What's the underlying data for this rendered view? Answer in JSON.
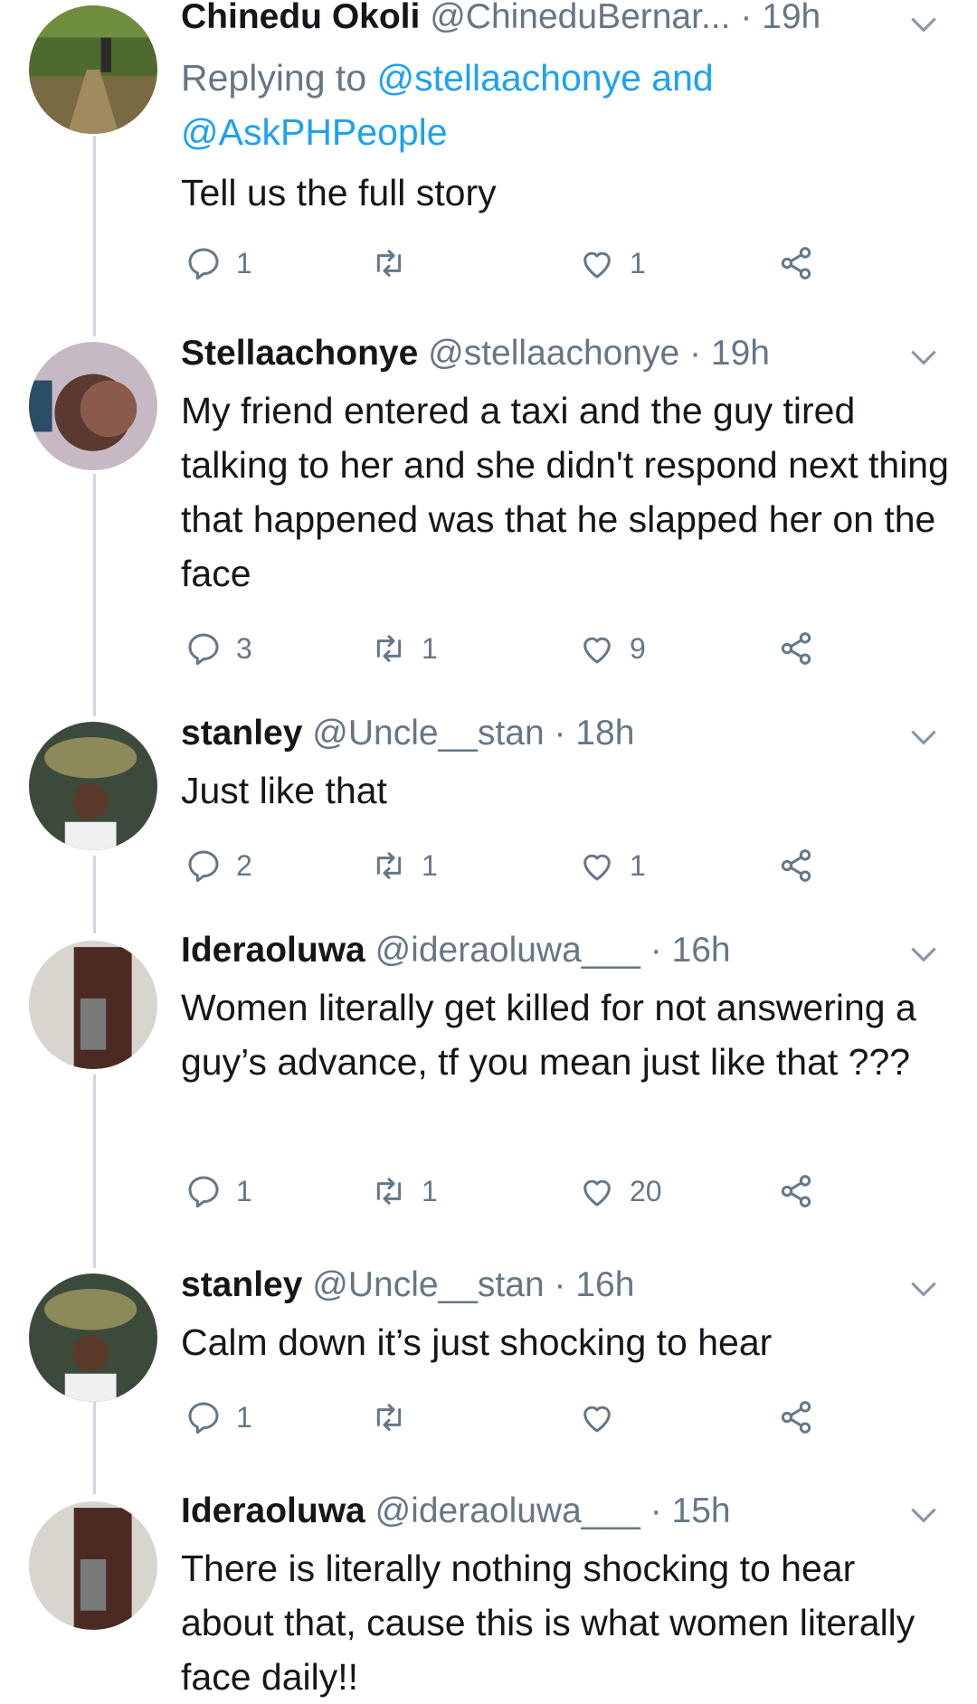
{
  "tweets": [
    {
      "name": "Chinedu Okoli",
      "handle": "@ChineduBernar...",
      "time": "· 19h",
      "replying_prefix": "Replying to",
      "replying_mention1": "@stellaachonye and",
      "replying_mention2": "@AskPHPeople",
      "text": "Tell us the full story",
      "replies": "1",
      "retweets": "",
      "likes": "1"
    },
    {
      "name": "Stellaachonye",
      "handle": "@stellaachonye",
      "time": "· 19h",
      "text": "My friend entered a taxi and the guy tired talking to her and she didn't respond next thing that happened was that he slapped her on the face",
      "replies": "3",
      "retweets": "1",
      "likes": "9"
    },
    {
      "name": "stanley",
      "handle": "@Uncle__stan",
      "time": "· 18h",
      "text": "Just like that",
      "replies": "2",
      "retweets": "1",
      "likes": "1"
    },
    {
      "name": "Ideraoluwa",
      "handle": "@ideraoluwa___",
      "time": "· 16h",
      "text": "Women literally get killed for not answering a guy’s advance, tf you mean just like that ???",
      "replies": "1",
      "retweets": "1",
      "likes": "20"
    },
    {
      "name": "stanley",
      "handle": "@Uncle__stan",
      "time": "· 16h",
      "text": "Calm down it’s just shocking to hear",
      "replies": "1",
      "retweets": "",
      "likes": ""
    },
    {
      "name": "Ideraoluwa",
      "handle": "@ideraoluwa___",
      "time": "· 15h",
      "text": "There is literally nothing shocking to hear about that, cause this is what women literally face daily!!"
    }
  ],
  "icons": {
    "reply": "reply-icon",
    "retweet": "retweet-icon",
    "like": "heart-icon",
    "share": "share-icon",
    "menu": "chevron-down-icon"
  },
  "colors": {
    "secondary_text": "#657786",
    "mention": "#1da1f2",
    "thread_line": "#ccd6dd"
  }
}
